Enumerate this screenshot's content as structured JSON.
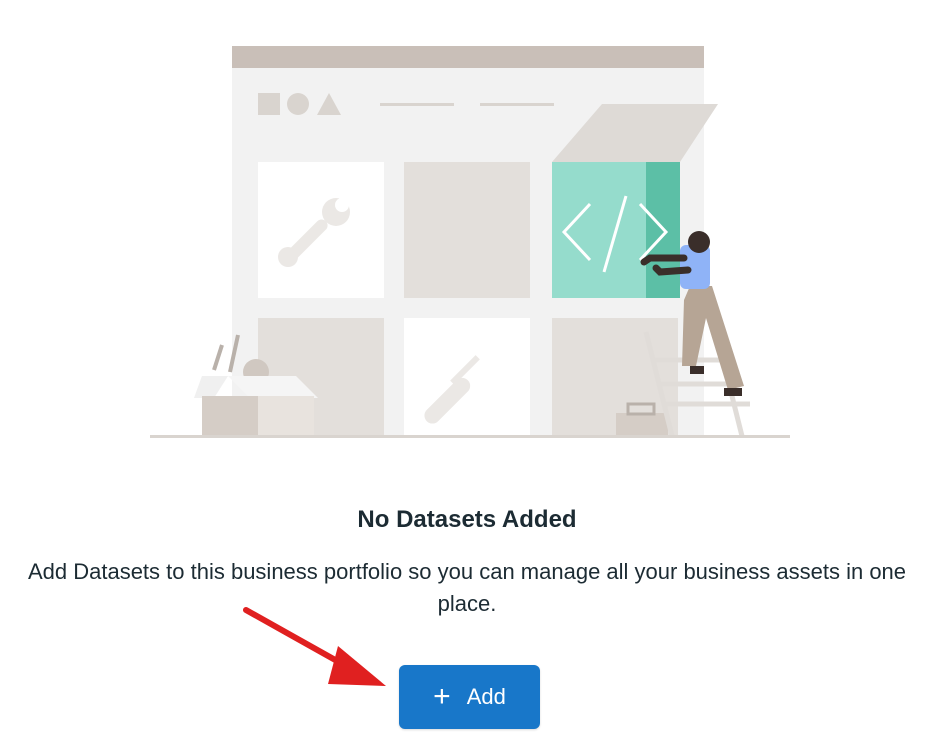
{
  "empty_state": {
    "title": "No Datasets Added",
    "description": "Add Datasets to this business portfolio so you can manage all your business assets in one place.",
    "illustration_icon": "developer-illustration"
  },
  "add_button": {
    "icon": "+",
    "label": "Add",
    "color": "#1877c9"
  },
  "annotation": {
    "arrow_color": "#e02020",
    "points_to": "add-button"
  }
}
